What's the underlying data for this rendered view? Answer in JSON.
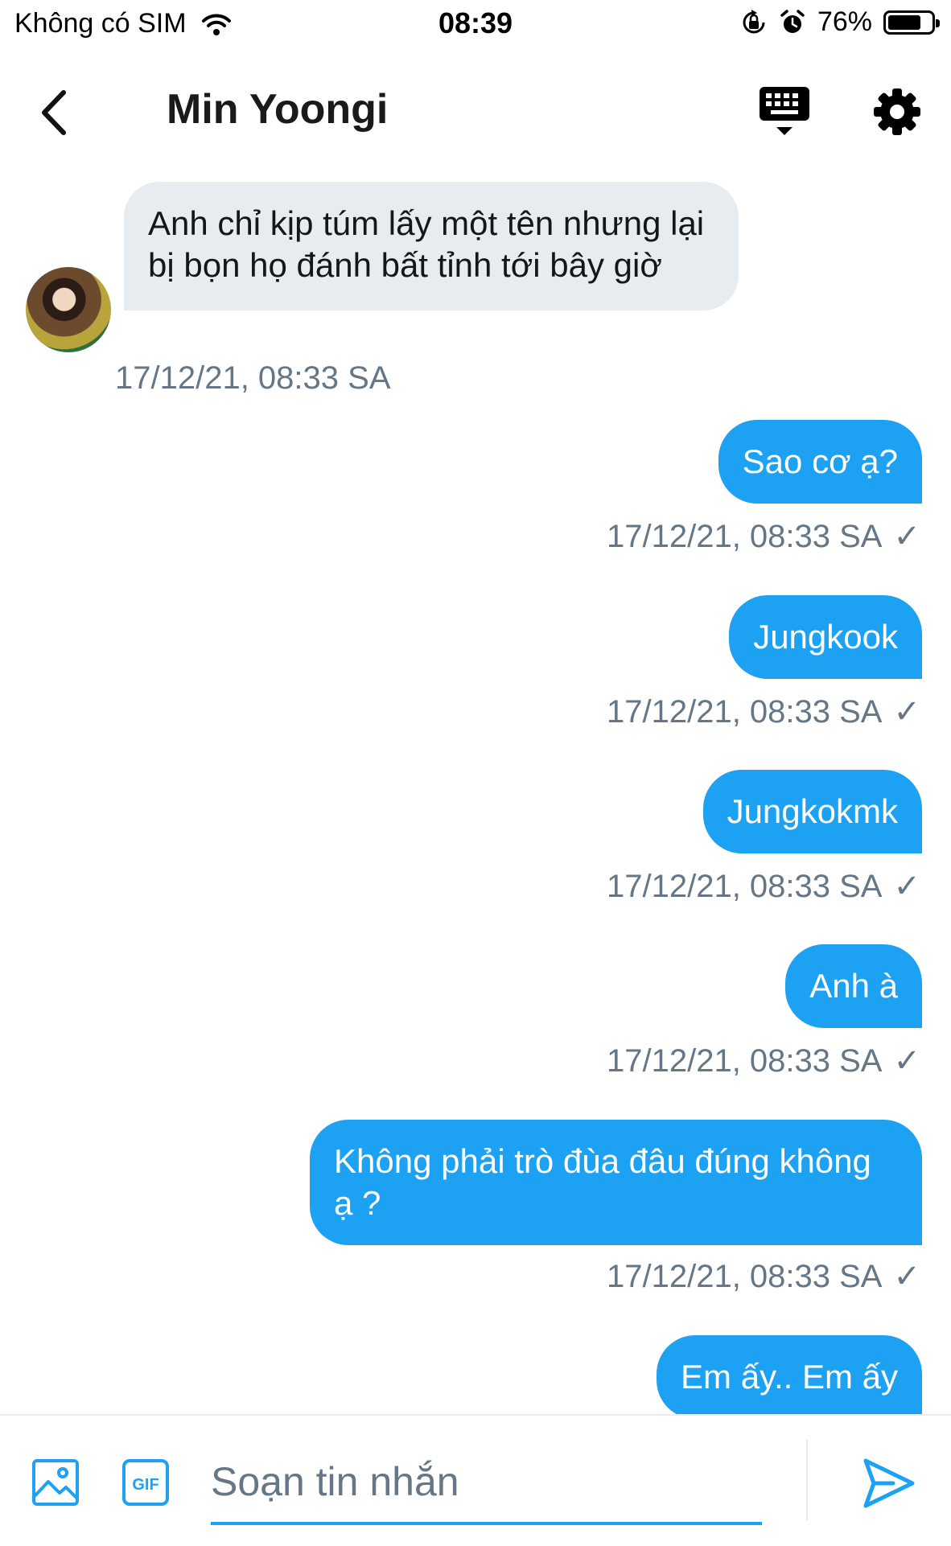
{
  "status_bar": {
    "carrier": "Không có SIM",
    "time": "08:39",
    "battery": "76%",
    "battery_level": 0.76
  },
  "header": {
    "title": "Min Yoongi",
    "icons": [
      "back-arrow-icon",
      "keyboard-icon",
      "gear-icon"
    ]
  },
  "conversation": {
    "incoming": [
      {
        "text": "Anh chỉ kịp túm lấy một tên nhưng lại bị bọn họ đánh bất tỉnh tới bây giờ",
        "time": "17/12/21, 08:33 SA"
      }
    ],
    "outgoing": [
      {
        "text": "Sao cơ ạ?",
        "time": "17/12/21, 08:33 SA",
        "status": "✓"
      },
      {
        "text": "Jungkook",
        "time": "17/12/21, 08:33 SA",
        "status": "✓"
      },
      {
        "text": "Jungkokmk",
        "time": "17/12/21, 08:33 SA",
        "status": "✓"
      },
      {
        "text": "Anh à",
        "time": "17/12/21, 08:33 SA",
        "status": "✓"
      },
      {
        "text": "Không phải trò đùa đâu đúng không ạ ?",
        "time": "17/12/21, 08:33 SA",
        "status": "✓"
      },
      {
        "text": "Em ấy.. Em ấy"
      }
    ]
  },
  "composer": {
    "placeholder": "Soạn tin nhắn",
    "gif_label": "GIF"
  },
  "colors": {
    "accent": "#1da1f2",
    "incoming_bubble": "#e6ecf0",
    "meta_text": "#657786"
  }
}
